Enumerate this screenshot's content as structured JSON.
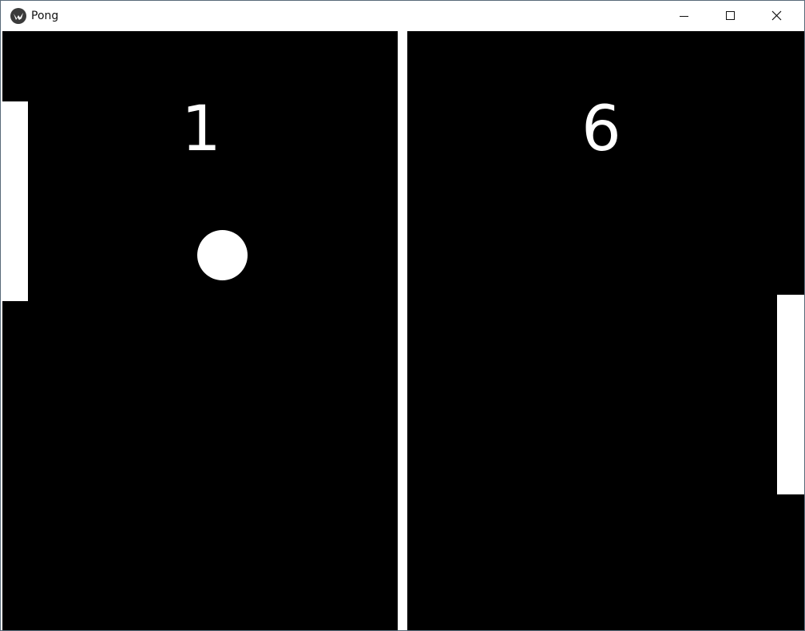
{
  "window": {
    "title": "Pong",
    "buttons": {
      "minimize_icon": "minimize-icon",
      "maximize_icon": "maximize-icon",
      "close_icon": "close-icon"
    }
  },
  "game": {
    "score_left": "1",
    "score_right": "6",
    "colors": {
      "background": "#000000",
      "foreground": "#ffffff"
    }
  }
}
